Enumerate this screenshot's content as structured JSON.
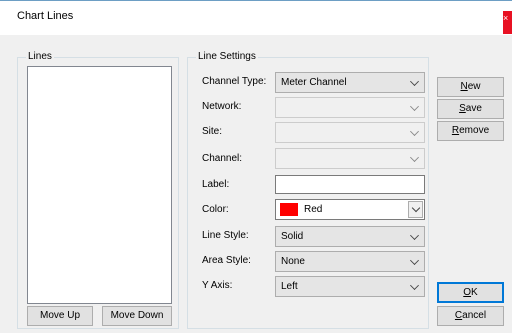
{
  "window": {
    "title": "Chart Lines",
    "close_glyph": "×"
  },
  "lines_group": {
    "legend": "Lines",
    "items": [],
    "move_up_label": "Move Up",
    "move_down_label": "Move Down"
  },
  "settings_group": {
    "legend": "Line Settings",
    "channel_type": {
      "label": "Channel Type:",
      "value": "Meter Channel"
    },
    "network": {
      "label": "Network:",
      "value": ""
    },
    "site": {
      "label": "Site:",
      "value": ""
    },
    "channel": {
      "label": "Channel:",
      "value": ""
    },
    "label_field": {
      "label": "Label:",
      "value": ""
    },
    "color": {
      "label": "Color:",
      "value": "Red",
      "swatch": "#ff0000"
    },
    "line_style": {
      "label": "Line Style:",
      "value": "Solid"
    },
    "area_style": {
      "label": "Area Style:",
      "value": "None"
    },
    "y_axis": {
      "label": "Y Axis:",
      "value": "Left"
    }
  },
  "actions": {
    "new_label": "New",
    "save_label": "Save",
    "remove_label": "Remove",
    "ok_label": "OK",
    "cancel_label": "Cancel"
  },
  "colors": {
    "accent": "#0078d7",
    "close": "#e81123"
  }
}
